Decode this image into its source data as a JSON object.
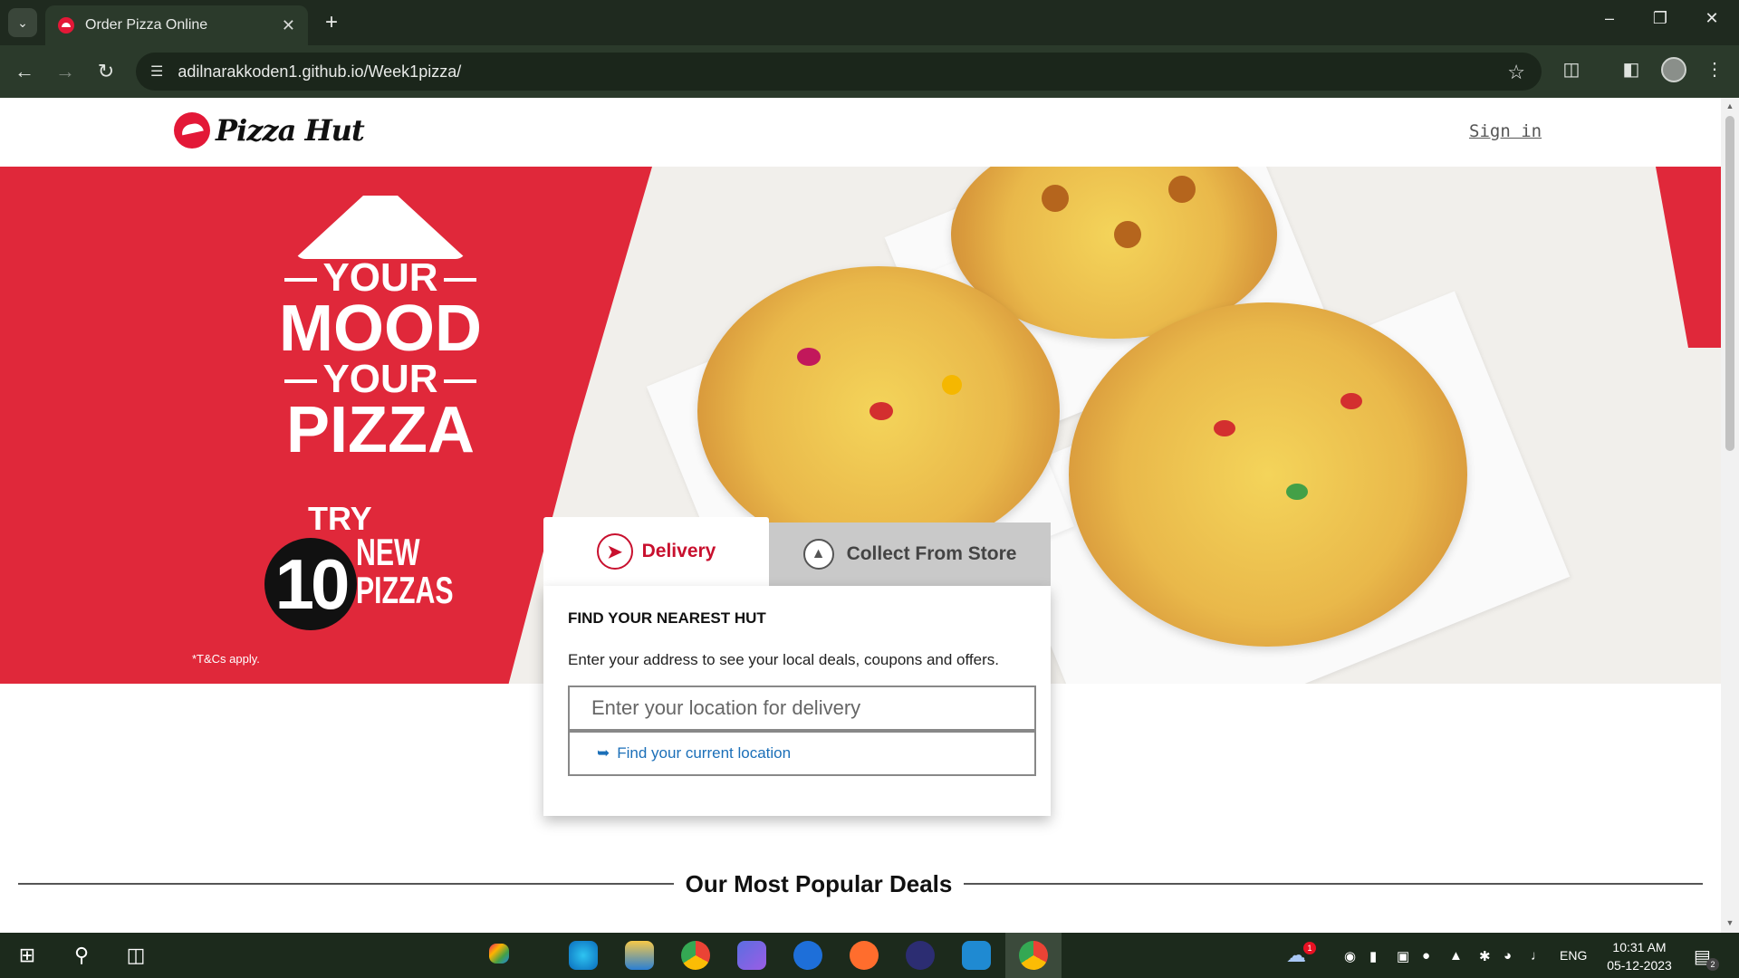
{
  "browser": {
    "tab_title": "Order Pizza Online",
    "url": "adilnarakkoden1.github.io/Week1pizza/",
    "icons": [
      "tab-list-icon",
      "close-tab-icon",
      "new-tab-icon",
      "minimize-icon",
      "restore-icon",
      "close-window-icon",
      "back-icon",
      "forward-icon",
      "reload-icon",
      "site-info-icon",
      "bookmark-star-icon",
      "extensions-icon",
      "side-panel-icon",
      "profile-avatar",
      "menu-icon"
    ]
  },
  "header": {
    "logo_text": "Pizza Hut",
    "signin_label": "Sign in"
  },
  "hero": {
    "line_your1": "YOUR",
    "line_mood": "MOOD",
    "line_your2": "YOUR",
    "line_pizza": "PIZZA",
    "try": "TRY",
    "ten": "10",
    "new": "NEW",
    "pizzas": "PIZZAS",
    "tnc": "*T&Cs apply."
  },
  "finder": {
    "tab_delivery": "Delivery",
    "tab_collect": "Collect From Store",
    "title": "FIND YOUR NEAREST HUT",
    "description": "Enter your address to see your local deals, coupons and offers.",
    "input_placeholder": "Enter your location for delivery",
    "find_current": "Find your current location"
  },
  "deals": {
    "title": "Our Most Popular Deals"
  },
  "taskbar": {
    "language": "ENG",
    "time": "10:31 AM",
    "date": "05-12-2023",
    "notification_count": "2",
    "weather_badge": "1"
  },
  "colors": {
    "brand_red": "#e0283a",
    "link_blue": "#1b6fb8",
    "chrome_dark": "#1f2a1f"
  }
}
